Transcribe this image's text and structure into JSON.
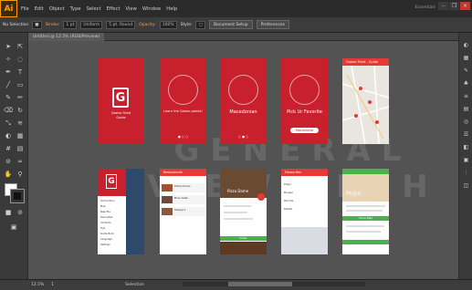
{
  "app": {
    "logo": "Ai",
    "workspace": "Essentials"
  },
  "menu": [
    "File",
    "Edit",
    "Object",
    "Type",
    "Select",
    "Effect",
    "View",
    "Window",
    "Help"
  ],
  "control_bar": {
    "selection": "No Selection",
    "stroke_label": "Stroke:",
    "stroke_value": "1 pt",
    "uniform": "Uniform",
    "round": "5 pt. Round",
    "opacity_label": "Opacity:",
    "opacity_value": "100%",
    "style_label": "Style:",
    "document_setup": "Document Setup",
    "preferences": "Preferences"
  },
  "document_tab": "Untitled @ 12.5% (RGB/Preview)",
  "status": {
    "zoom": "12.5%",
    "page": "1",
    "mode": "Selection"
  },
  "artboards_row1": [
    {
      "title": "Gastro Point",
      "subtitle": "Guide"
    },
    {
      "title": "Learn the Gastro points!",
      "subtitle": ""
    },
    {
      "title": "Macedonian",
      "subtitle": ""
    },
    {
      "title": "Pick Ur Favorite",
      "subtitle": "",
      "button": "Macedonia"
    },
    {
      "title": "Gastro Point - Guide",
      "subtitle": ""
    }
  ],
  "artboards_row2": [
    {
      "menu_items": [
        "Home Menu",
        "Map",
        "Near Me",
        "Favourites",
        "Contacts",
        "Tips",
        "Guide Book",
        "Language",
        "Settings"
      ]
    },
    {
      "header": "Restaurants",
      "items": [
        "Pizza Dome",
        "Blue Gate",
        "Skopje's"
      ]
    },
    {
      "header": "",
      "tag": "Pizza Dome",
      "button": "Order"
    },
    {
      "header": "Favourites",
      "items": [
        "Pinjur",
        "Burger",
        "Tavche",
        "Kebab"
      ]
    },
    {
      "header": "Pinjur",
      "title": "Pinjur",
      "button": "Show Map"
    }
  ],
  "watermark": "GENERAL  VIEW  TECH",
  "colors": {
    "brand_red": "#c8202c",
    "accent_green": "#49b24a",
    "ui_dark": "#2b2b2b"
  }
}
